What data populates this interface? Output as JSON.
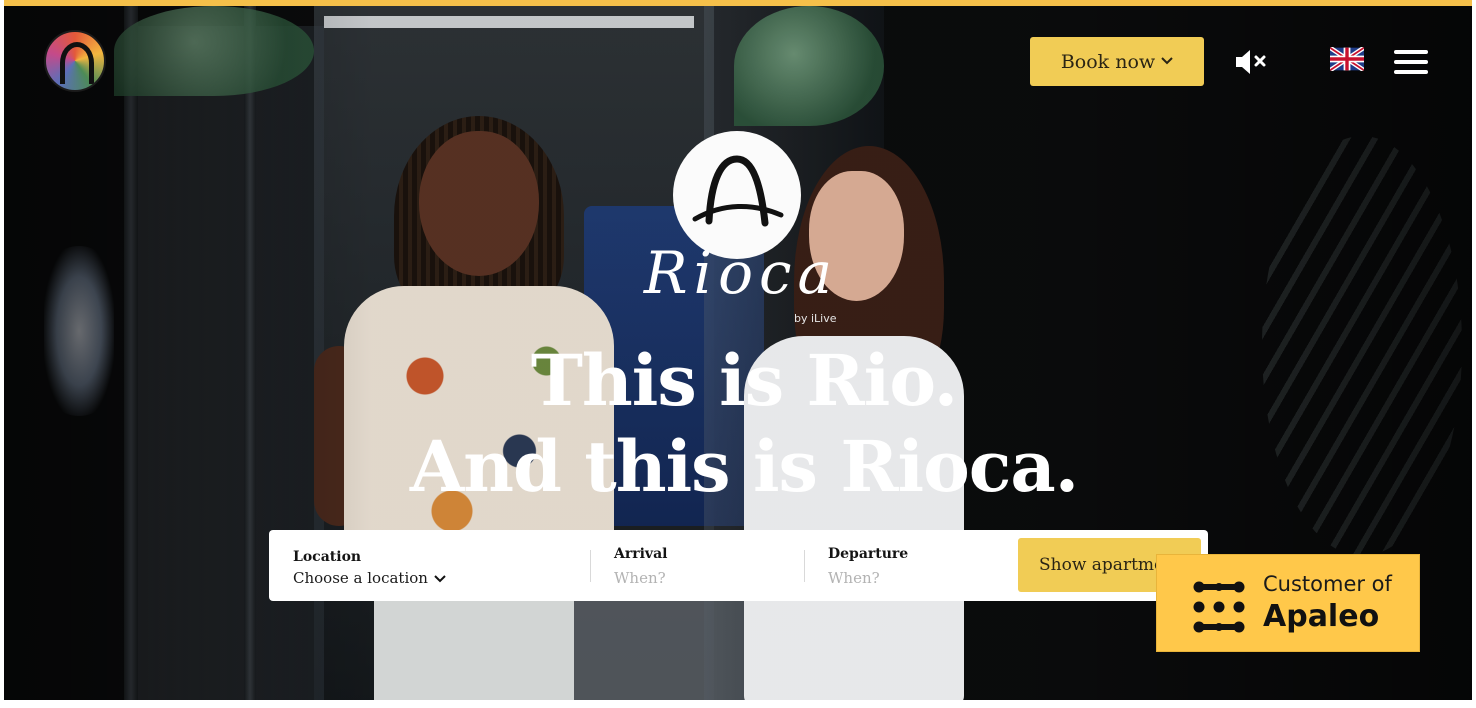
{
  "header": {
    "book_label": "Book now",
    "chevron_icon": "chevron-down-icon",
    "mute_icon": "speaker-muted-icon",
    "language_icon": "uk-flag-icon",
    "menu_icon": "hamburger-menu-icon",
    "logo_icon": "rioca-colorful-arch-logo"
  },
  "brand": {
    "wordmark": "Rioca",
    "sub": "by iLive"
  },
  "hero": {
    "line1": "This is Rio.",
    "line2": "And this is Rioca."
  },
  "search": {
    "location_label": "Location",
    "location_value": "Choose a location",
    "arrival_label": "Arrival",
    "arrival_placeholder": "When?",
    "departure_label": "Departure",
    "departure_placeholder": "When?",
    "submit_label": "Show apartments"
  },
  "badge": {
    "prefix": "Customer of",
    "name": "Apaleo"
  },
  "colors": {
    "accent_yellow": "#f1cc55",
    "badge_yellow": "#ffc84a",
    "top_border": "#f5c04a"
  }
}
